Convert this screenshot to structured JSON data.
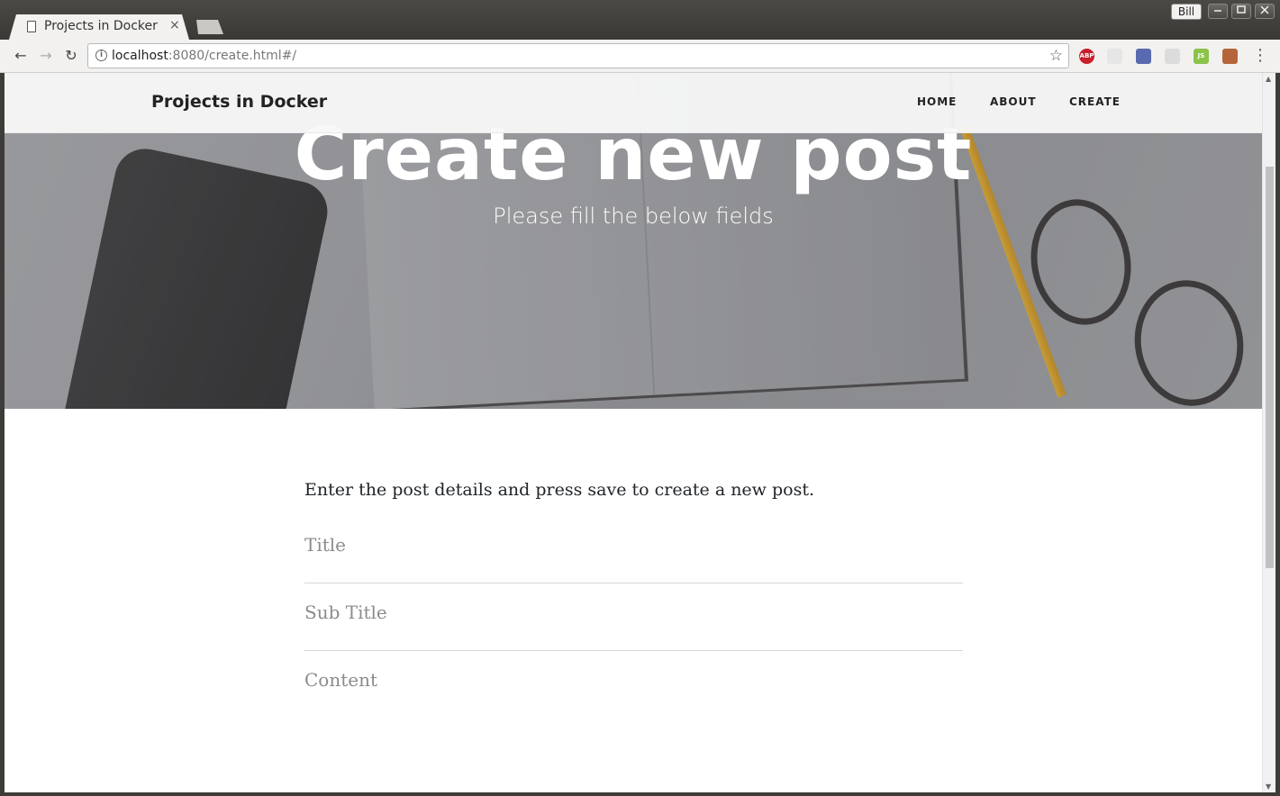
{
  "browser": {
    "tab_title": "Projects in Docker",
    "tab_close": "×",
    "profile_name": "Bill",
    "url_host": "localhost",
    "url_rest": ":8080/create.html#/",
    "back_glyph": "←",
    "forward_glyph": "→",
    "reload_glyph": "↻",
    "info_glyph": "i",
    "star_glyph": "☆",
    "menu_glyph": "⋮",
    "extensions": [
      {
        "name": "abp-extension-icon",
        "label": "ABP",
        "color": "#c8202a"
      },
      {
        "name": "sync-extension-icon",
        "label": "",
        "color": "#e6e6e6"
      },
      {
        "name": "colorpicker-extension-icon",
        "label": "",
        "color": "#5a6ab0"
      },
      {
        "name": "grid-extension-icon",
        "label": "",
        "color": "#dcdcdc"
      },
      {
        "name": "js-extension-icon",
        "label": "JS",
        "color": "#8bc34a"
      },
      {
        "name": "monkey-extension-icon",
        "label": "",
        "color": "#b5653a"
      }
    ]
  },
  "site": {
    "brand": "Projects in Docker",
    "nav": [
      {
        "label": "HOME"
      },
      {
        "label": "ABOUT"
      },
      {
        "label": "CREATE"
      }
    ]
  },
  "hero": {
    "title": "Create new post",
    "subtitle": "Please fill the below fields"
  },
  "form": {
    "intro": "Enter the post details and press save to create a new post.",
    "title_placeholder": "Title",
    "subtitle_placeholder": "Sub Title",
    "content_placeholder": "Content"
  }
}
